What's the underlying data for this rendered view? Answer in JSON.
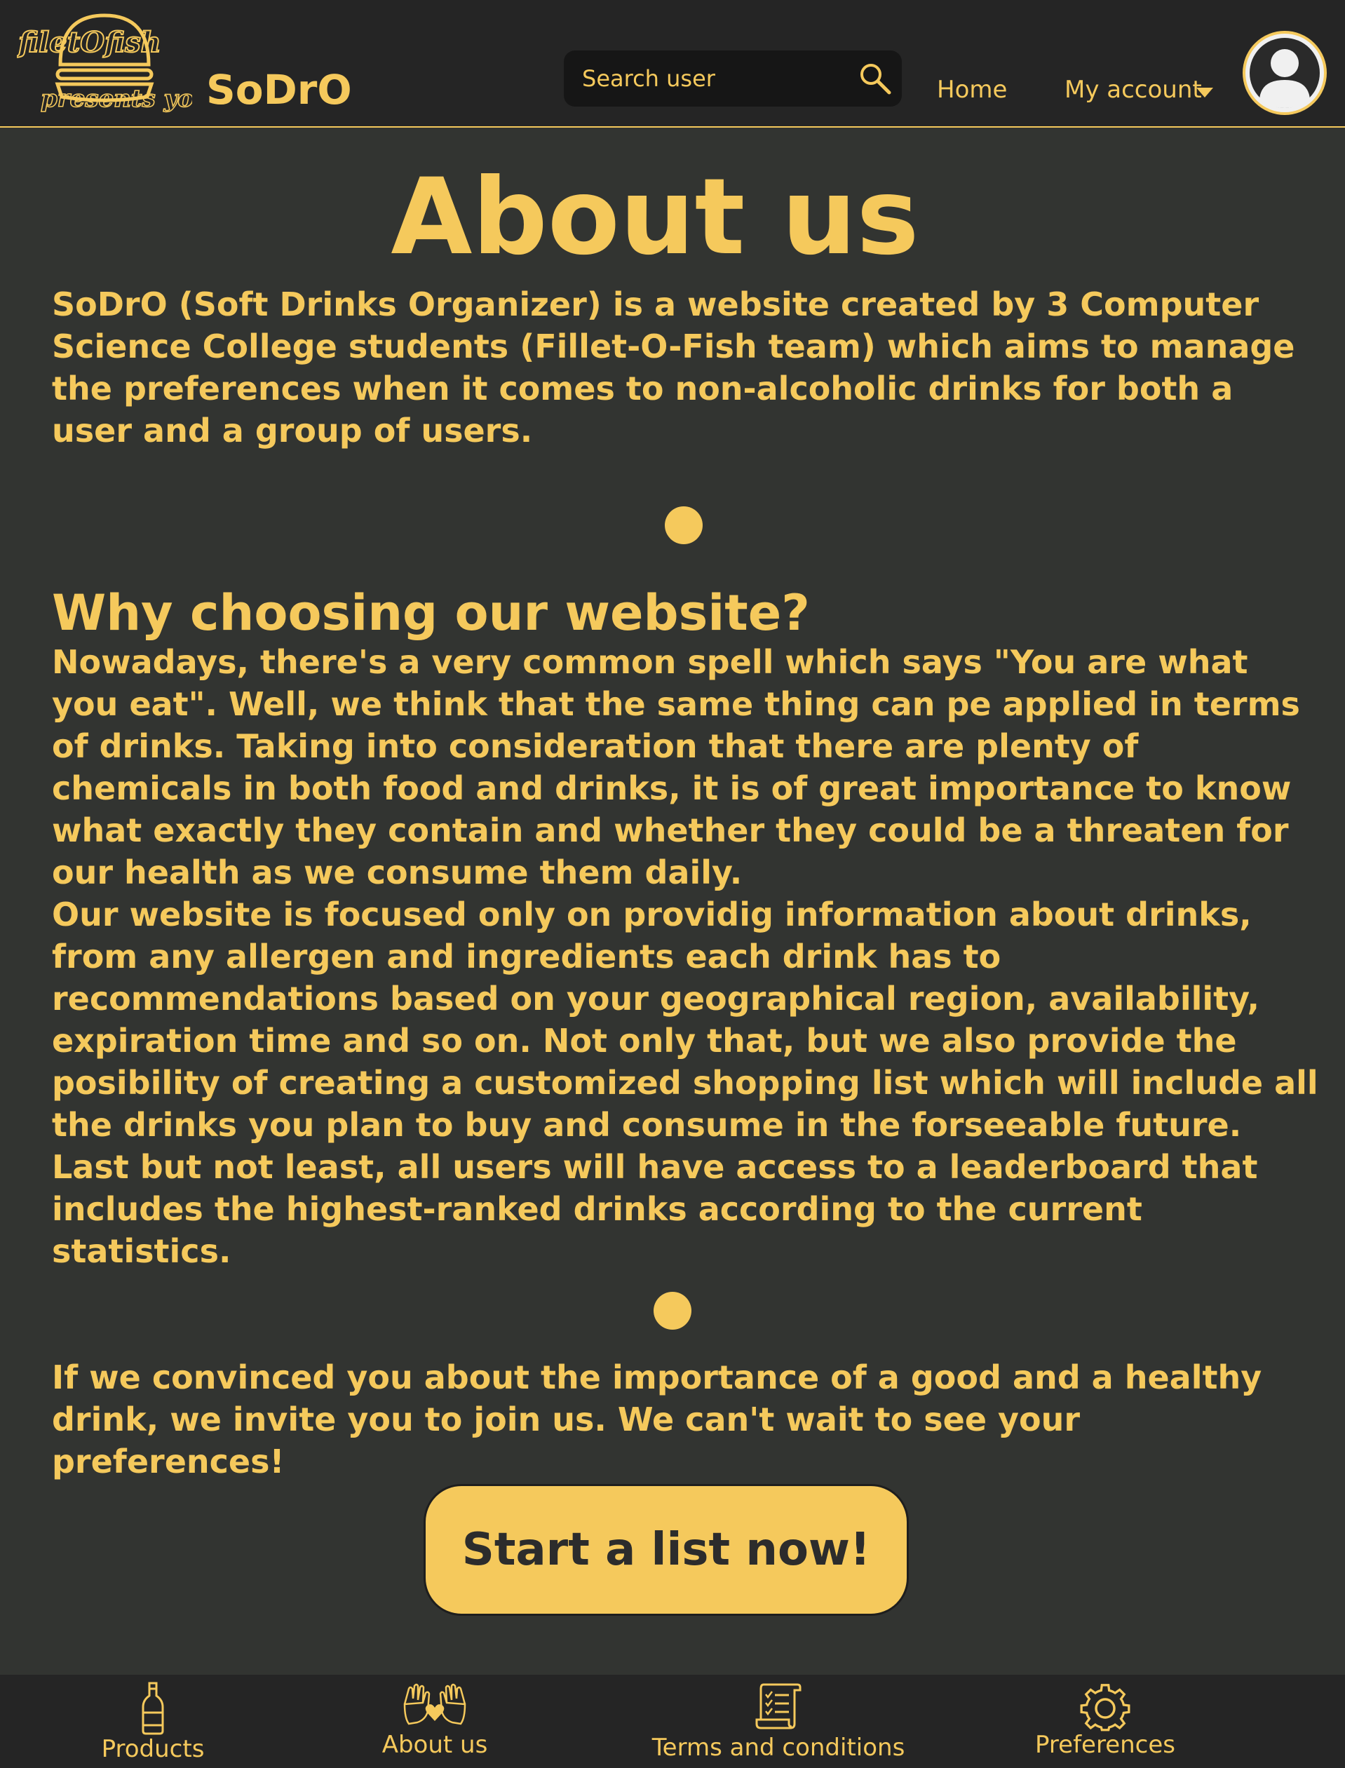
{
  "header": {
    "logo_text": "filetOfish presents you",
    "brand": "SoDrO",
    "search": {
      "placeholder": "Search user",
      "value": ""
    },
    "nav": {
      "home": "Home",
      "my_account": "My account"
    }
  },
  "main": {
    "title": "About us",
    "intro": "SoDrO (Soft Drinks Organizer) is a website created by 3 Computer Science College students (Fillet-O-Fish team) which aims to manage the preferences when it comes to non-alcoholic drinks for both a user and a group of users.",
    "why_heading": "Why choosing our website?",
    "why_paragraphs": [
      "Nowadays, there's a very common spell which says \"You are what you eat\". Well, we think that the same thing can pe applied in terms of drinks. Taking into consideration that there are plenty of chemicals in both food and drinks, it is of great importance to know what exactly they contain and whether they could be a threaten for our health as we consume them daily.",
      "Our website is focused only on providig information about drinks, from any allergen and ingredients each drink has to recommendations based on your geographical region, availability, expiration time and so on. Not only that, but we also provide the posibility of creating a customized shopping list which will include all the drinks you plan to buy and consume in the forseeable future.",
      "Last but not least, all users will have access to a leaderboard that includes the highest-ranked drinks according to the current statistics."
    ],
    "outro": "If we convinced you about the importance of a good and a healthy drink, we invite you to join us. We can't wait to see your preferences!",
    "cta": "Start a list now!"
  },
  "bottom_nav": [
    {
      "label": "Products",
      "icon": "bottle-icon"
    },
    {
      "label": "About us",
      "icon": "hands-heart-icon"
    },
    {
      "label": "Terms and conditions",
      "icon": "scroll-checklist-icon"
    },
    {
      "label": "Preferences",
      "icon": "gear-icon"
    }
  ],
  "colors": {
    "accent": "#f5c95c",
    "background": "#323431",
    "header_bg": "#252525",
    "search_bg": "#161616",
    "button_text": "#2c2c2c"
  }
}
